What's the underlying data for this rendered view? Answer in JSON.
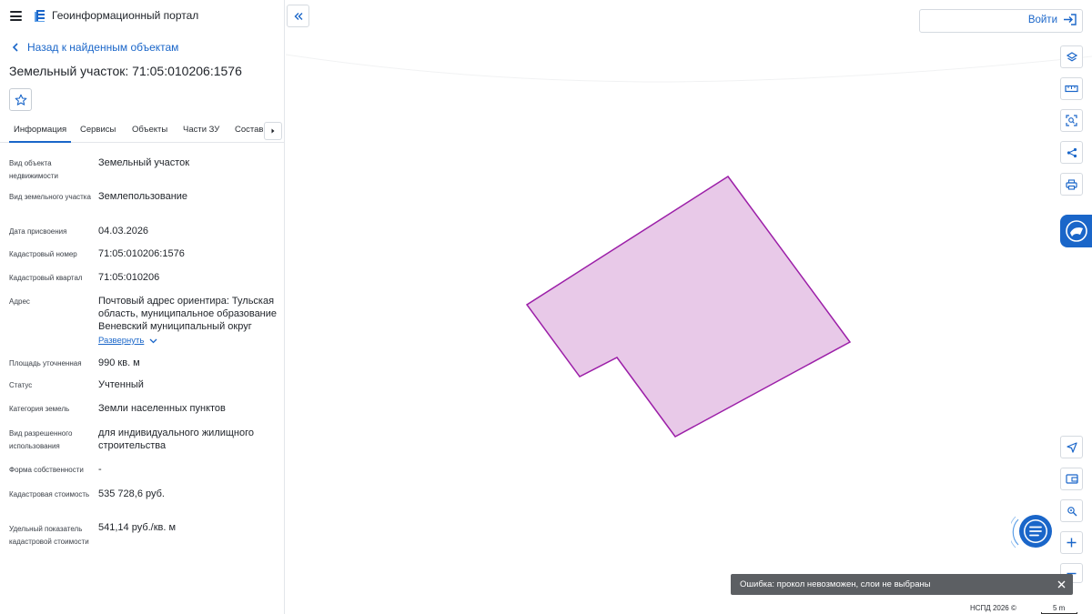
{
  "app": {
    "title": "Геоинформационный портал"
  },
  "nav": {
    "back_label": "Назад к найденным объектам"
  },
  "object": {
    "title": "Земельный участок: 71:05:010206:1576"
  },
  "tabs": [
    {
      "label": "Информация",
      "active": true
    },
    {
      "label": "Сервисы",
      "active": false
    },
    {
      "label": "Объекты",
      "active": false
    },
    {
      "label": "Части ЗУ",
      "active": false
    },
    {
      "label": "Состав",
      "active": false
    }
  ],
  "properties": [
    {
      "label": "Вид объекта недвижимости",
      "value": "Земельный участок"
    },
    {
      "label": "Вид земельного участка",
      "value": "Землепользование"
    },
    {
      "label": "Дата присвоения",
      "value": "04.03.2026"
    },
    {
      "label": "Кадастровый номер",
      "value": "71:05:010206:1576"
    },
    {
      "label": "Кадастровый квартал",
      "value": "71:05:010206"
    },
    {
      "label": "Адрес",
      "value": "Почтовый адрес ориентира: Тульская область, муниципальное образование Веневский муниципальный округ"
    },
    {
      "label": "Площадь уточненная",
      "value": "990 кв. м"
    },
    {
      "label": "Статус",
      "value": "Учтенный"
    },
    {
      "label": "Категория земель",
      "value": "Земли населенных пунктов"
    },
    {
      "label": "Вид разрешенного использования",
      "value": "для индивидуального жилищного строительства"
    },
    {
      "label": "Форма собственности",
      "value": "-"
    },
    {
      "label": "Кадастровая стоимость",
      "value": "535 728,6 руб."
    },
    {
      "label": "Удельный показатель кадастровой стоимости",
      "value": "541,14 руб./кв. м"
    }
  ],
  "expand_label": "Развернуть",
  "login": {
    "label": "Войти"
  },
  "toast": {
    "message": "Ошибка: прокол невозможен, слои не выбраны"
  },
  "map": {
    "attribution": "НСПД 2026 ©",
    "scale_label": "5 m",
    "parcel_fill": "#e8c9e8",
    "parcel_stroke": "#9c1fa8"
  },
  "colors": {
    "accent": "#1a66c9",
    "toast_bg": "#5c5f63"
  },
  "icons": {
    "tools": [
      "layers-icon",
      "ruler-icon",
      "select-area-icon",
      "share-icon",
      "print-icon"
    ],
    "bottom_tools": [
      "navigate-icon",
      "wallet-icon",
      "location-icon",
      "zoom-in-icon"
    ]
  }
}
